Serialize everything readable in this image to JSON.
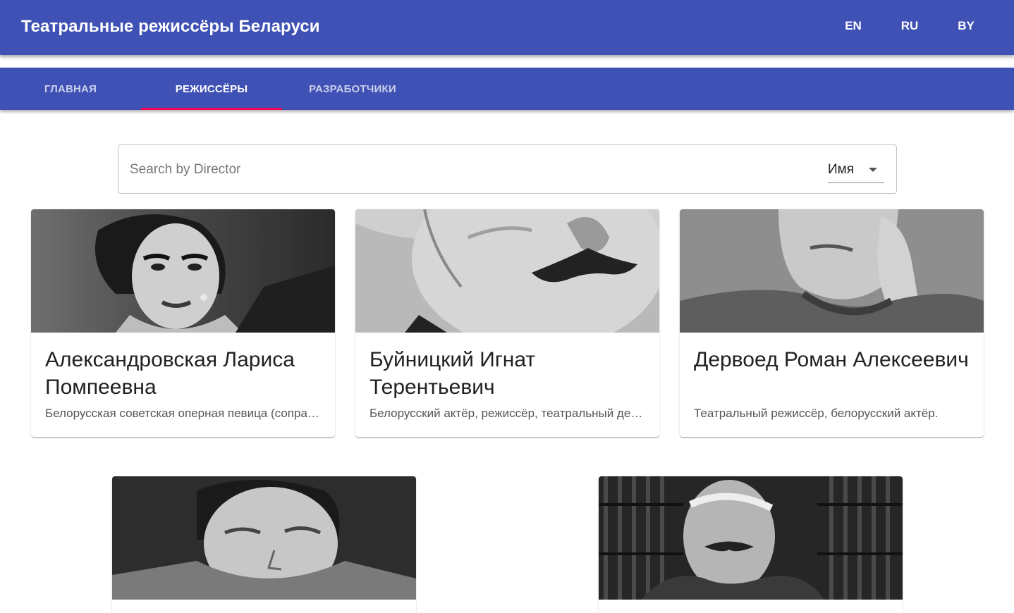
{
  "app": {
    "title": "Театральные режиссёры Беларуси",
    "languages": [
      "EN",
      "RU",
      "BY"
    ]
  },
  "tabs": [
    {
      "label": "Главная",
      "active": false
    },
    {
      "label": "Режиссёры",
      "active": true
    },
    {
      "label": "Разработчики",
      "active": false
    }
  ],
  "search": {
    "placeholder": "Search by Director",
    "value": "",
    "filter_selected": "Имя"
  },
  "directors": [
    {
      "name": "Александровская Лариса Помпеевна",
      "description": "Белорусская советская оперная певица (сопрано), режиссёр."
    },
    {
      "name": "Буйницкий Игнат Терентьевич",
      "description": "Белорусский актёр, режиссёр, театральный деятель."
    },
    {
      "name": "Дервоед Роман Алексеевич",
      "description": "Театральный режиссёр, белорусский актёр."
    },
    {
      "name": "",
      "description": ""
    },
    {
      "name": "",
      "description": ""
    }
  ],
  "colors": {
    "primary": "#3f51b5",
    "accent_indicator": "#f50057"
  }
}
